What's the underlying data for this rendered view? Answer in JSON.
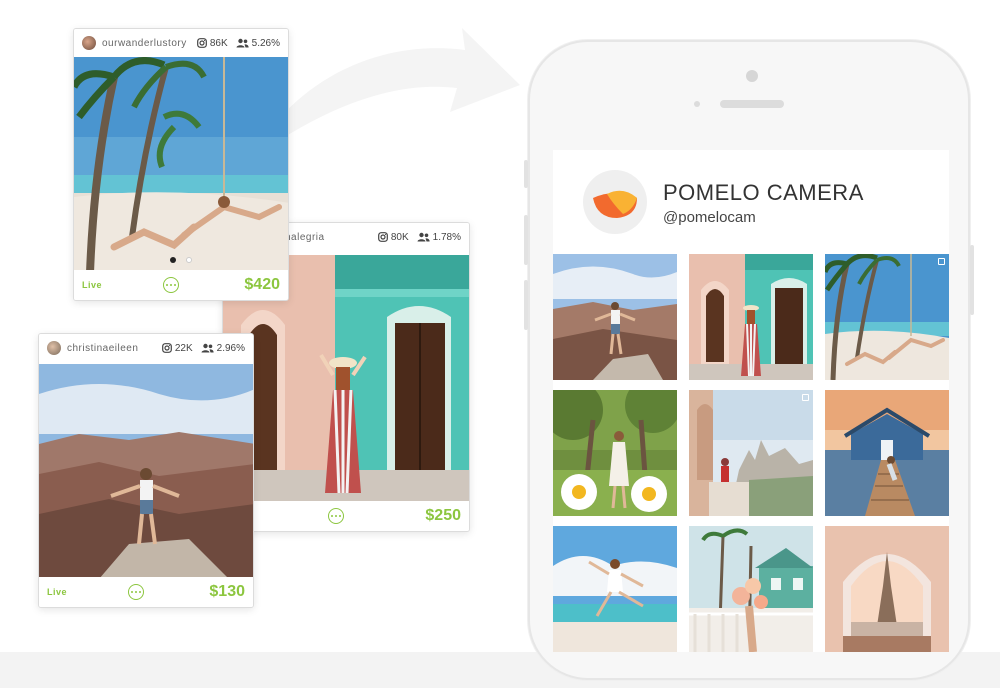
{
  "cards": [
    {
      "id": "card-1",
      "username": "ourwanderlustory",
      "followers": "86K",
      "engagement": "5.26%",
      "status": "Live",
      "price": "$420",
      "carousel_dots": 2,
      "active_dot": 0
    },
    {
      "id": "card-2",
      "username": "nalegria",
      "followers": "80K",
      "engagement": "1.78%",
      "status": "",
      "price": "$250"
    },
    {
      "id": "card-3",
      "username": "christinaeileen",
      "followers": "22K",
      "engagement": "2.96%",
      "status": "Live",
      "price": "$130"
    }
  ],
  "profile": {
    "name": "POMELO CAMERA",
    "handle": "@pomelocam"
  },
  "grid_tiles": [
    {
      "name": "grand-canyon",
      "multi": false
    },
    {
      "name": "green-building",
      "multi": false
    },
    {
      "name": "beach-palms",
      "multi": true
    },
    {
      "name": "daisies-park",
      "multi": false
    },
    {
      "name": "balcony-city",
      "multi": true
    },
    {
      "name": "pier-house",
      "multi": false
    },
    {
      "name": "beach-jump",
      "multi": false
    },
    {
      "name": "flowers-houses",
      "multi": false
    },
    {
      "name": "eiffel-window",
      "multi": false
    }
  ],
  "icons": {
    "followers": "instagram-icon",
    "engagement": "people-icon",
    "more": "more-dots-icon",
    "arrow": "curved-arrow-icon"
  },
  "colors": {
    "accent_green": "#8cc63f",
    "logo_orange": "#f26a2e",
    "logo_yellow": "#f9b233"
  }
}
